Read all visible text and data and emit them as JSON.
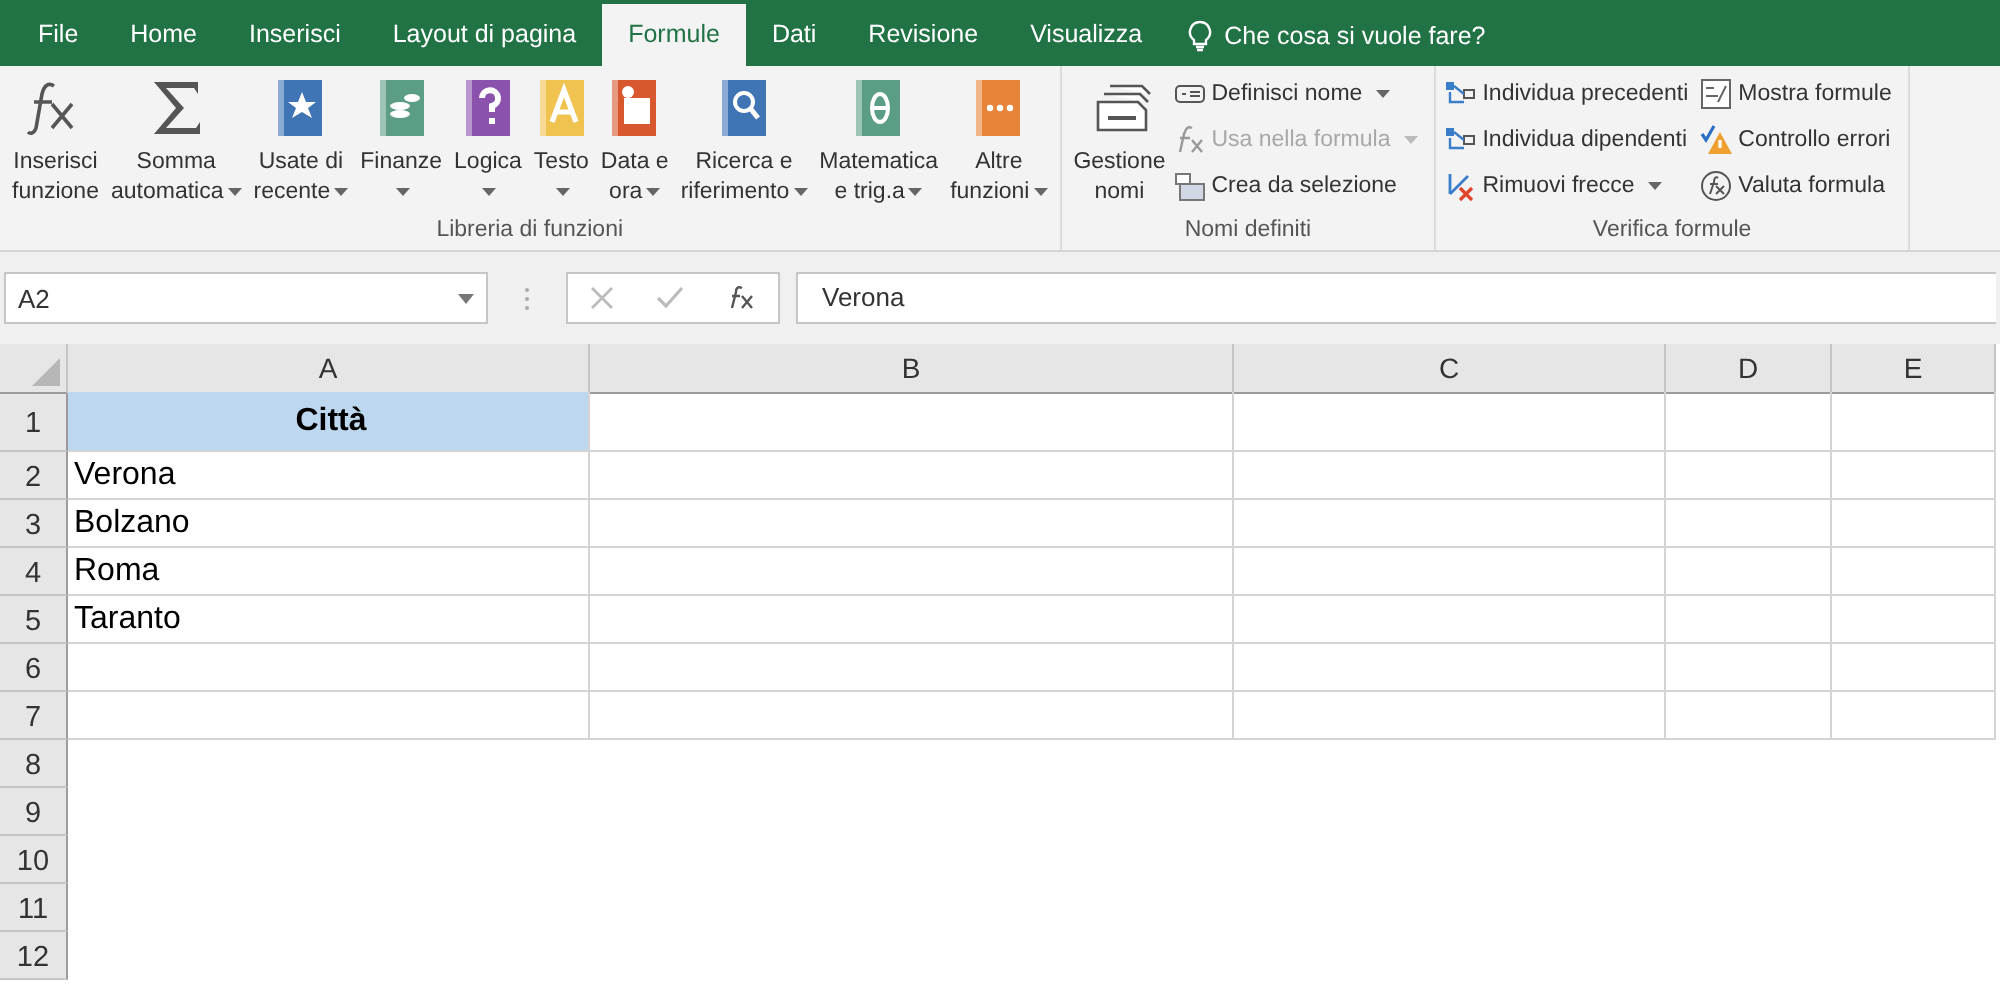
{
  "tabs": [
    {
      "label": "File",
      "selected": false
    },
    {
      "label": "Home",
      "selected": false
    },
    {
      "label": "Inserisci",
      "selected": false
    },
    {
      "label": "Layout di pagina",
      "selected": false
    },
    {
      "label": "Formule",
      "selected": true
    },
    {
      "label": "Dati",
      "selected": false
    },
    {
      "label": "Revisione",
      "selected": false
    },
    {
      "label": "Visualizza",
      "selected": false
    }
  ],
  "tell_me": {
    "placeholder": "Che cosa si vuole fare?"
  },
  "ribbon_groups": [
    {
      "label": "Libreria di funzioni",
      "items": [
        {
          "kind": "large",
          "lines": [
            "Inserisci",
            "funzione"
          ],
          "dropdown": false
        },
        {
          "kind": "large",
          "lines": [
            "Somma",
            "automatica"
          ],
          "dropdown": true
        },
        {
          "kind": "large",
          "lines": [
            "Usate di",
            "recente"
          ],
          "dropdown": true
        },
        {
          "kind": "large",
          "lines": [
            "Finanze"
          ],
          "dropdown": true
        },
        {
          "kind": "large",
          "lines": [
            "Logica"
          ],
          "dropdown": true
        },
        {
          "kind": "large",
          "lines": [
            "Testo"
          ],
          "dropdown": true
        },
        {
          "kind": "large",
          "lines": [
            "Data e",
            "ora"
          ],
          "dropdown": true
        },
        {
          "kind": "large",
          "lines": [
            "Ricerca e",
            "riferimento"
          ],
          "dropdown": true
        },
        {
          "kind": "large",
          "lines": [
            "Matematica",
            "e trig.a"
          ],
          "dropdown": true
        },
        {
          "kind": "large",
          "lines": [
            "Altre",
            "funzioni"
          ],
          "dropdown": true
        }
      ]
    },
    {
      "label": "Nomi definiti",
      "items": [
        {
          "kind": "large",
          "lines": [
            "Gestione",
            "nomi"
          ],
          "dropdown": false
        },
        {
          "kind": "stack",
          "buttons": [
            {
              "label": "Definisci nome",
              "dropdown": true,
              "disabled": false
            },
            {
              "label": "Usa nella formula",
              "dropdown": true,
              "disabled": true
            },
            {
              "label": "Crea da selezione",
              "dropdown": false,
              "disabled": false
            }
          ]
        }
      ]
    },
    {
      "label": "Verifica formule",
      "items": [
        {
          "kind": "stack",
          "buttons": [
            {
              "label": "Individua precedenti",
              "dropdown": false,
              "disabled": false
            },
            {
              "label": "Individua dipendenti",
              "dropdown": false,
              "disabled": false
            },
            {
              "label": "Rimuovi frecce",
              "dropdown": true,
              "disabled": false
            }
          ]
        },
        {
          "kind": "stack",
          "buttons": [
            {
              "label": "Mostra formule",
              "dropdown": false,
              "disabled": false
            },
            {
              "label": "Controllo errori",
              "dropdown": false,
              "disabled": false
            },
            {
              "label": "Valuta formula",
              "dropdown": false,
              "disabled": false
            }
          ]
        }
      ]
    }
  ],
  "name_box": {
    "value": "A2"
  },
  "formula_bar": {
    "value": "Verona"
  },
  "sheet": {
    "columns": [
      "A",
      "B",
      "C",
      "D",
      "E"
    ],
    "rows": [
      {
        "number": "1",
        "kind": "header",
        "cells": [
          "Città"
        ]
      },
      {
        "number": "2",
        "kind": "data",
        "cells": [
          "Verona"
        ]
      },
      {
        "number": "3",
        "kind": "data",
        "cells": [
          "Bolzano"
        ]
      },
      {
        "number": "4",
        "kind": "data",
        "cells": [
          "Roma"
        ]
      },
      {
        "number": "5",
        "kind": "data",
        "cells": [
          "Taranto"
        ]
      },
      {
        "number": "6",
        "kind": "data",
        "cells": []
      },
      {
        "number": "7",
        "kind": "data",
        "cells": []
      }
    ],
    "empty_row_numbers": [
      "8",
      "9",
      "10",
      "11",
      "12"
    ]
  }
}
